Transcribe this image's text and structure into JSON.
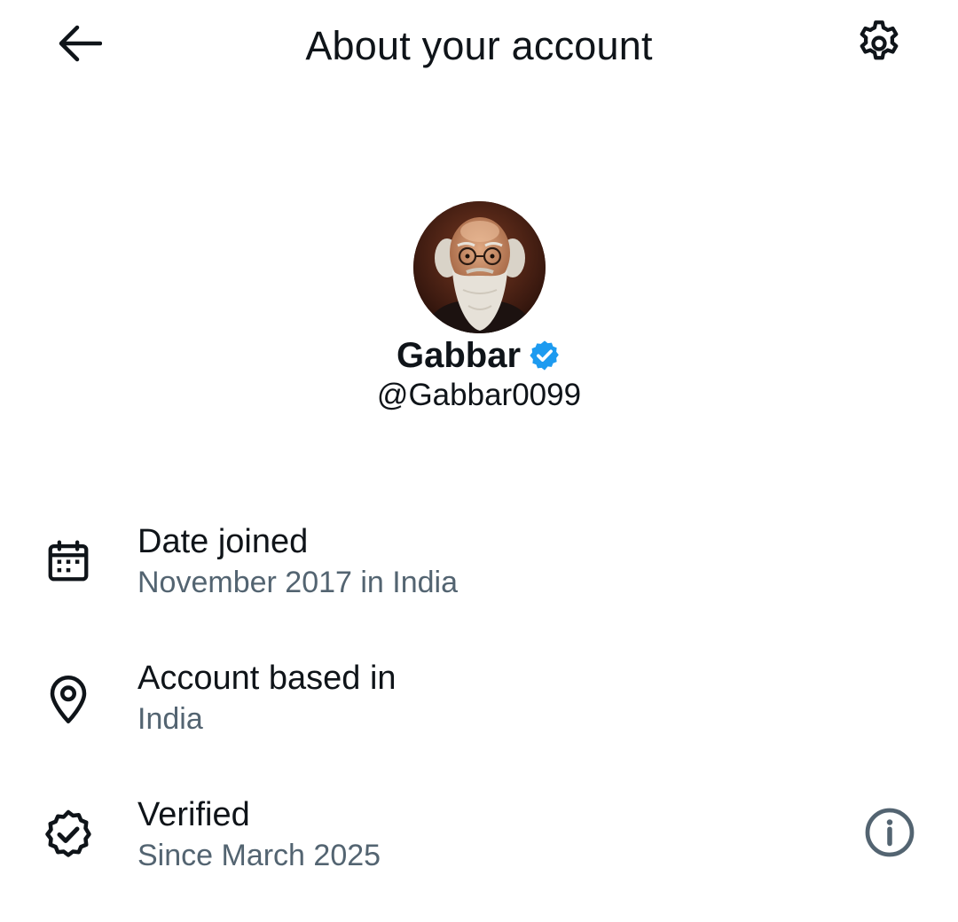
{
  "header": {
    "title": "About your account",
    "back_icon": "arrow-left-icon",
    "settings_icon": "gear-icon"
  },
  "profile": {
    "display_name": "Gabbar",
    "handle": "@Gabbar0099",
    "verified_badge_icon": "verified-badge-icon",
    "verified_badge_color": "#1d9bf0"
  },
  "details": [
    {
      "icon": "calendar-icon",
      "title": "Date joined",
      "subtitle": "November 2017 in India"
    },
    {
      "icon": "location-pin-icon",
      "title": "Account based in",
      "subtitle": "India"
    },
    {
      "icon": "verified-outline-icon",
      "title": "Verified",
      "subtitle": "Since March 2025",
      "action_icon": "info-icon"
    }
  ],
  "colors": {
    "text_primary": "#0f1419",
    "text_secondary": "#536471",
    "accent": "#1d9bf0"
  }
}
